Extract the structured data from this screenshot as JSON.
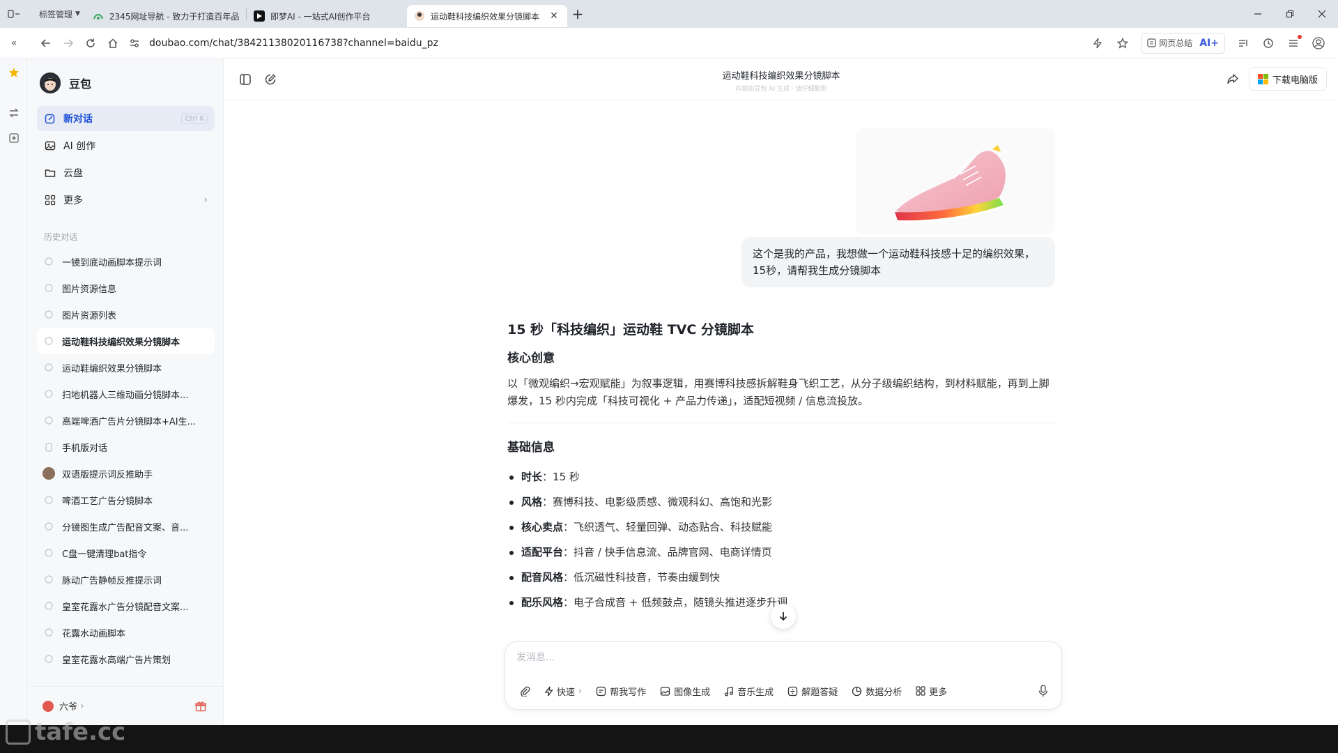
{
  "browser": {
    "tab_group_label": "标签管理",
    "tabs": [
      {
        "title": "2345网址导航 - 致力于打造百年品牌",
        "active": false
      },
      {
        "title": "即梦AI - 一站式AI创作平台",
        "active": false
      },
      {
        "title": "运动鞋科技编织效果分镜脚本",
        "active": true
      }
    ],
    "url": "doubao.com/chat/38421138020116738?channel=baidu_pz",
    "summary_label": "网页总结",
    "ai_label": "AI+"
  },
  "sidebar": {
    "brand_name": "豆包",
    "nav": [
      {
        "label": "新对话",
        "shortcut": "Ctrl K"
      },
      {
        "label": "AI 创作"
      },
      {
        "label": "云盘"
      },
      {
        "label": "更多"
      }
    ],
    "history_label": "历史对话",
    "history": [
      "一镜到底动画脚本提示词",
      "图片资源信息",
      "图片资源列表",
      "运动鞋科技编织效果分镜脚本",
      "运动鞋编织效果分镜脚本",
      "扫地机器人三维动画分镜脚本...",
      "高端啤酒广告片分镜脚本+AI生...",
      "手机版对话",
      "双语版提示词反推助手",
      "啤酒工艺广告分镜脚本",
      "分镜图生成广告配音文案、音...",
      "C盘一键清理bat指令",
      "脉动广告静帧反推提示词",
      "皇室花露水广告分镜配音文案...",
      "花露水动画脚本",
      "皇室花露水高端广告片策划"
    ],
    "user_name": "六爷"
  },
  "conversation": {
    "title": "运动鞋科技编织效果分镜脚本",
    "subtitle": "内容由豆包 AI 生成  ·  请仔细甄别",
    "download_label": "下载电脑版",
    "user_message": "这个是我的产品，我想做一个运动鞋科技感十足的编织效果，15秒，请帮我生成分镜脚本",
    "answer": {
      "title": "15 秒「科技编织」运动鞋 TVC 分镜脚本",
      "section1_title": "核心创意",
      "section1_body": "以「微观编织→宏观赋能」为叙事逻辑，用赛博科技感拆解鞋身飞织工艺，从分子级编织结构，到材料赋能，再到上脚爆发，15 秒内完成「科技可视化 + 产品力传递」，适配短视频 / 信息流投放。",
      "section2_title": "基础信息",
      "items": [
        {
          "label": "时长",
          "value": "15 秒"
        },
        {
          "label": "风格",
          "value": "赛博科技、电影级质感、微观科幻、高饱和光影"
        },
        {
          "label": "核心卖点",
          "value": "飞织透气、轻量回弹、动态贴合、科技赋能"
        },
        {
          "label": "适配平台",
          "value": "抖音 / 快手信息流、品牌官网、电商详情页"
        },
        {
          "label": "配音风格",
          "value": "低沉磁性科技音，节奏由缓到快"
        },
        {
          "label": "配乐风格",
          "value": "电子合成音 + 低频鼓点，随镜头推进逐步升调"
        }
      ]
    }
  },
  "composer": {
    "placeholder": "发消息...",
    "tools": [
      {
        "label": "快速",
        "icon": "lightning-icon"
      },
      {
        "label": "帮我写作",
        "icon": "pen-icon"
      },
      {
        "label": "图像生成",
        "icon": "image-icon"
      },
      {
        "label": "音乐生成",
        "icon": "music-icon"
      },
      {
        "label": "解题答疑",
        "icon": "question-icon"
      },
      {
        "label": "数据分析",
        "icon": "chart-icon"
      },
      {
        "label": "更多",
        "icon": "grid-icon"
      }
    ]
  },
  "watermark": "tafe.cc",
  "colors": {
    "accent": "#1d4fd8",
    "sidebar_bg": "#f7f8fa",
    "active_nav_bg": "#e6ebf6"
  }
}
